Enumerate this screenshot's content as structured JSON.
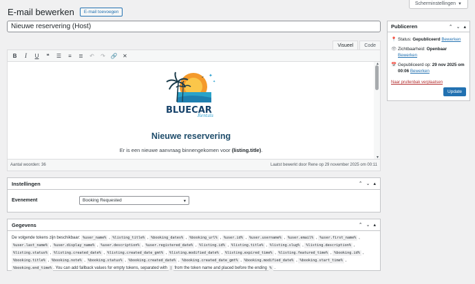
{
  "screen_options": "Scherminstellingen",
  "page": {
    "title": "E-mail bewerken",
    "add_button": "E-mail toevoegen"
  },
  "post_title": "Nieuwe reservering (Host)",
  "editor": {
    "tabs": [
      "Visueel",
      "Code"
    ],
    "heading": "Nieuwe reservering",
    "intro_prefix": "Er is een nieuwe aanvraag binnengekomen voor ",
    "intro_bold": "(listing.title)",
    "intro_suffix": ".",
    "logo_text": "BLUECAR",
    "logo_script": "Rentals",
    "word_count": "Aantal woorden: 36",
    "last_edited": "Laatst bewerkt door Rene op 29 november 2025 om 00:11"
  },
  "settings_box": {
    "title": "Instellingen",
    "event_label": "Evenement",
    "event_value": "Booking Requested"
  },
  "data_box": {
    "title": "Gegevens",
    "intro": "De volgende tokens zijn beschikbaar:",
    "tokens": [
      "%user_name%",
      "%listing_title%",
      "%booking_dates%",
      "%booking_url%",
      "%user.id%",
      "%user.username%",
      "%user.email%",
      "%user.first_name%",
      "%user.last_name%",
      "%user.display_name%",
      "%user.description%",
      "%user.registered_date%",
      "%listing.id%",
      "%listing.title%",
      "%listing.slug%",
      "%listing.description%",
      "%listing.status%",
      "%listing.created_date%",
      "%listing.created_date_gmt%",
      "%listing.modified_date%",
      "%listing.expired_time%",
      "%listing.featured_time%",
      "%booking.id%",
      "%booking.title%",
      "%booking.note%",
      "%booking.status%",
      "%booking.created_date%",
      "%booking.created_date_gmt%",
      "%booking.modified_date%",
      "%booking.start_time%",
      "%booking.end_time%"
    ],
    "fallback_a": ". You can add fallback values for empty tokens, separated with",
    "pipe": "|",
    "fallback_b": "from the token name and placed before the ending",
    "percent": "%",
    "end": "."
  },
  "publish": {
    "title": "Publiceren",
    "status_label": "Status:",
    "status_value": "Gepubliceerd",
    "visibility_label": "Zichtbaarheid:",
    "visibility_value": "Openbaar",
    "published_label": "Gepubliceerd op:",
    "published_value": "29 nov 2025 om 00:06",
    "edit_link": "Bewerken",
    "trash": "Naar prullenbak verplaatsen",
    "update": "Update"
  }
}
